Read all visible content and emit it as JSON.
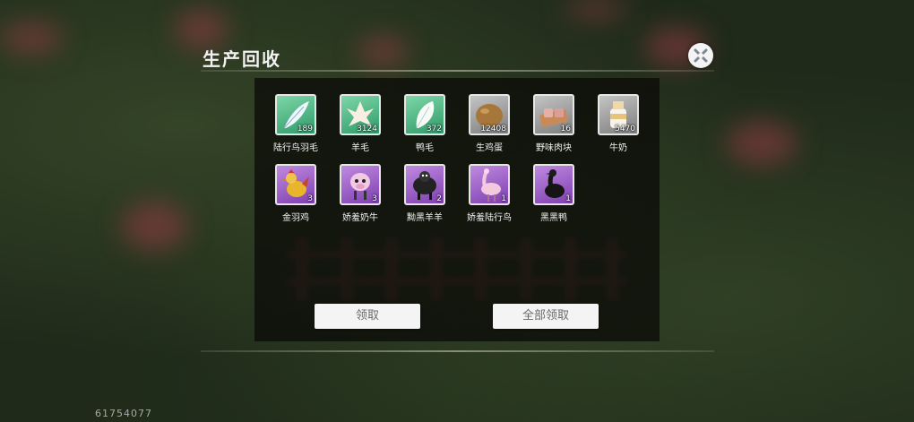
{
  "header": {
    "title": "生产回收"
  },
  "items": [
    {
      "label": "陆行鸟羽毛",
      "count": "189",
      "icon": "feather-icon",
      "bg": "green"
    },
    {
      "label": "羊毛",
      "count": "3124",
      "icon": "wool-icon",
      "bg": "green"
    },
    {
      "label": "鸭毛",
      "count": "372",
      "icon": "feather-icon",
      "bg": "green"
    },
    {
      "label": "生鸡蛋",
      "count": "12408",
      "icon": "egg-icon",
      "bg": "gray"
    },
    {
      "label": "野味肉块",
      "count": "16",
      "icon": "meat-icon",
      "bg": "gray"
    },
    {
      "label": "牛奶",
      "count": "5470",
      "icon": "milk-bottle-icon",
      "bg": "gray"
    },
    {
      "label": "金羽鸡",
      "count": "3",
      "icon": "rooster-icon",
      "bg": "purple"
    },
    {
      "label": "娇羞奶牛",
      "count": "3",
      "icon": "cow-icon",
      "bg": "purple"
    },
    {
      "label": "黝黑羊羊",
      "count": "2",
      "icon": "black-sheep-icon",
      "bg": "purple"
    },
    {
      "label": "娇羞陆行鸟",
      "count": "1",
      "icon": "ostrich-icon",
      "bg": "purple"
    },
    {
      "label": "黑黑鸭",
      "count": "1",
      "icon": "black-duck-icon",
      "bg": "purple"
    }
  ],
  "buttons": {
    "claim": "领取",
    "claim_all": "全部领取"
  },
  "footer": {
    "uid": "61754077"
  },
  "colors": {
    "panel": "#0c0c08",
    "green_slot": "#3fae7a",
    "purple_slot": "#9a5bc9",
    "gray_slot": "#9e9e9e"
  }
}
